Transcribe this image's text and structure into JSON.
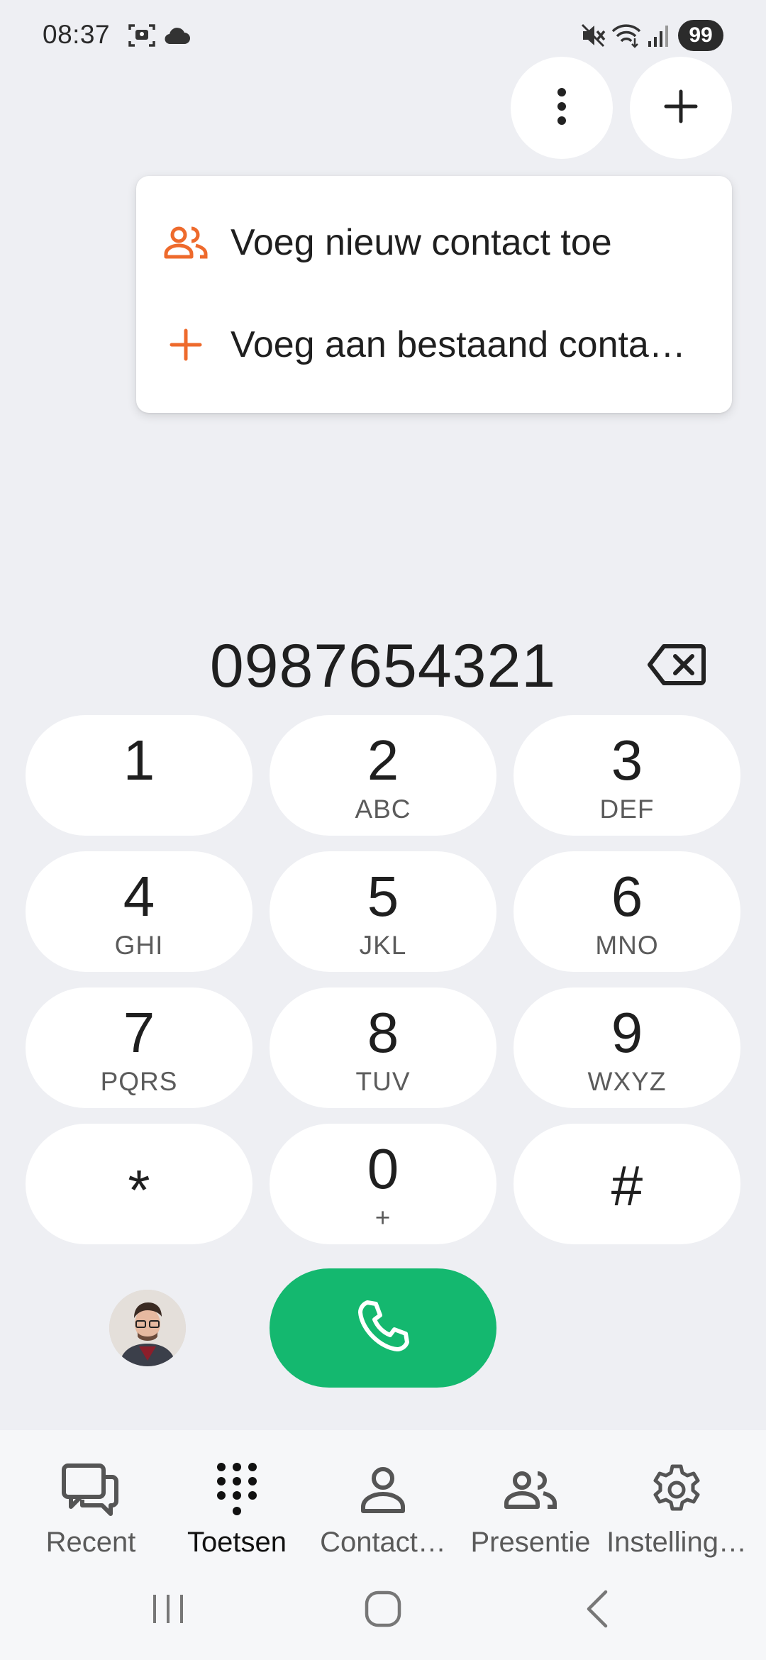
{
  "status_bar": {
    "time": "08:37",
    "battery": "99",
    "icons": [
      "screenshot-icon",
      "cloud-icon",
      "mute-icon",
      "wifi-icon",
      "signal-icon"
    ]
  },
  "top_actions": {
    "more_icon": "more-vertical-icon",
    "add_icon": "plus-icon"
  },
  "popup_menu": {
    "items": [
      {
        "label": "Voeg nieuw contact toe",
        "icon": "people-icon"
      },
      {
        "label": "Voeg aan bestaand conta…",
        "icon": "plus-icon"
      }
    ],
    "accent_color": "#ee6a2c"
  },
  "dialer": {
    "number": "0987654321",
    "keys": [
      {
        "digit": "1",
        "letters": ""
      },
      {
        "digit": "2",
        "letters": "ABC"
      },
      {
        "digit": "3",
        "letters": "DEF"
      },
      {
        "digit": "4",
        "letters": "GHI"
      },
      {
        "digit": "5",
        "letters": "JKL"
      },
      {
        "digit": "6",
        "letters": "MNO"
      },
      {
        "digit": "7",
        "letters": "PQRS"
      },
      {
        "digit": "8",
        "letters": "TUV"
      },
      {
        "digit": "9",
        "letters": "WXYZ"
      },
      {
        "digit": "*",
        "letters": ""
      },
      {
        "digit": "0",
        "letters": "+"
      },
      {
        "digit": "#",
        "letters": ""
      }
    ],
    "call_color": "#14b86f"
  },
  "bottom_nav": {
    "items": [
      {
        "label": "Recent",
        "icon": "chat-icon"
      },
      {
        "label": "Toetsen",
        "icon": "dialpad-icon",
        "active": true
      },
      {
        "label": "Contact…",
        "icon": "person-icon"
      },
      {
        "label": "Presentie",
        "icon": "people-icon"
      },
      {
        "label": "Instelling…",
        "icon": "gear-icon"
      }
    ]
  }
}
